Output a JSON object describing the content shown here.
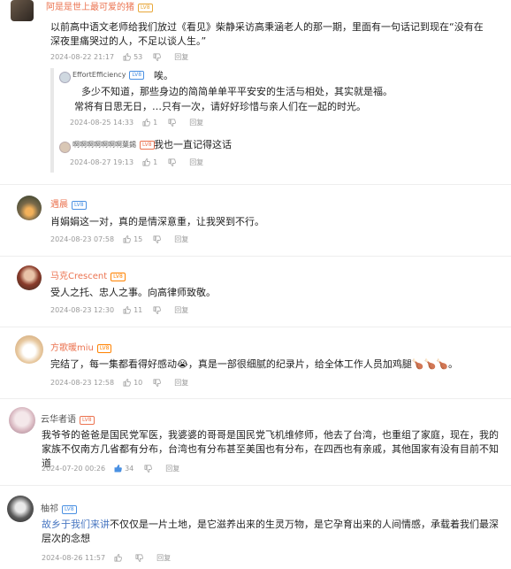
{
  "colors": {
    "name_orange": "#eb7350",
    "name_gray": "#555555",
    "badge_gold": "#e8a73a",
    "badge_orange": "#ff8200",
    "badge_blue": "#4a90e2"
  },
  "comments": [
    {
      "user": "阿是是世上最可爱的猪",
      "badge": "LV8",
      "text": "以前高中语文老师给我们放过《看见》柴静采访高秉涵老人的那一期，里面有一句话记到现在“没有在深夜里痛哭过的人，不足以谈人生。”",
      "time": "2024-08-22 21:17",
      "likes": "53",
      "reply": "回复",
      "replies": [
        {
          "user": "EffortEfficiency",
          "badge": "LV8",
          "text": "唉。",
          "text2": "多少不知道，那些身边的简简单单平平安安的生活与相处，其实就是福。",
          "text3": "常将有日思无日，…只有一次，请好好珍惜与亲人们在一起的时光。",
          "time": "2024-08-25 14:33",
          "likes": "1",
          "reply": "回复"
        },
        {
          "user": "啊啊啊啊啊啊啊葉錫",
          "badge": "LV8",
          "text": "我也一直记得这话",
          "time": "2024-08-27 19:13",
          "likes": "1",
          "reply": "回复"
        }
      ]
    },
    {
      "user": "遇晨",
      "badge": "LV8",
      "text": "肖娟娟这一对，真的是情深意重，让我哭到不行。",
      "time": "2024-08-23 07:58",
      "likes": "15",
      "reply": "回复"
    },
    {
      "user": "马克Crescent",
      "badge": "LV8",
      "text": "受人之托、忠人之事。向高律师致敬。",
      "time": "2024-08-23 12:30",
      "likes": "11",
      "reply": "回复"
    },
    {
      "user": "方歌暖miu",
      "badge": "LV8",
      "text": "完结了，每一集都看得好感动😭，真是一部很细腻的纪录片，给全体工作人员加鸡腿🍗🍗🍗。",
      "time": "2024-08-23 12:58",
      "likes": "10",
      "reply": "回复"
    },
    {
      "user": "云华者语",
      "badge": "LV8",
      "text": "我爷爷的爸爸是国民党军医，我婆婆的哥哥是国民党飞机维修师，他去了台湾，也重组了家庭，现在，我的家族不仅南方几省都有分布，台湾也有分布甚至美国也有分布，在四西也有亲戚，其他国家有没有目前不知道",
      "time": "2024-07-20 00:26",
      "likes": "34",
      "reply": "回复"
    },
    {
      "user": "柚祁",
      "badge": "LV8",
      "text": "故乡于我们来讲",
      "text_rest": "不仅仅是一片土地，是它滋养出来的生灵万物，是它孕育出来的人间情感，承载着我们最深层次的念想",
      "time": "2024-08-26 11:57",
      "likes": "",
      "reply": "回复"
    }
  ]
}
